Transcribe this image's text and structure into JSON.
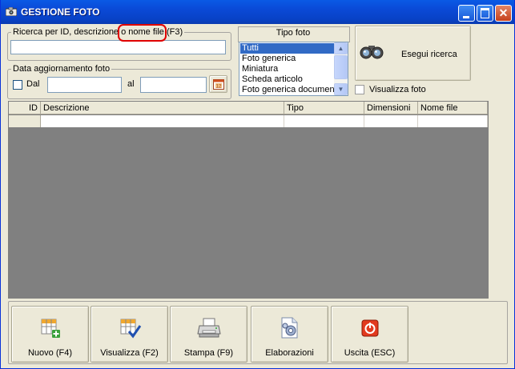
{
  "window": {
    "title": "GESTIONE FOTO"
  },
  "search": {
    "group_label": "Ricerca per ID, descrizione o nome file (F3)",
    "value": "",
    "placeholder": ""
  },
  "date_filter": {
    "group_label": "Data aggiornamento foto",
    "from_label": "Dal",
    "from_value": "",
    "to_label": "al",
    "to_value": ""
  },
  "photo_type": {
    "header": "Tipo foto",
    "options": [
      "Tutti",
      "Foto generica",
      "Miniatura",
      "Scheda articolo",
      "Foto generica document"
    ],
    "selected": "Tutti"
  },
  "actions": {
    "search_button": "Esegui ricerca",
    "show_photo_label": "Visualizza foto"
  },
  "table": {
    "columns": [
      "ID",
      "Descrizione",
      "Tipo",
      "Dimensioni",
      "Nome file"
    ],
    "rows": [
      [
        "",
        "",
        "",
        "",
        ""
      ]
    ]
  },
  "toolbar": {
    "new": "Nuovo (F4)",
    "view": "Visualizza (F2)",
    "print": "Stampa (F9)",
    "process": "Elaborazioni",
    "exit": "Uscita (ESC)"
  },
  "colors": {
    "titlebar": "#0a49d6",
    "selection": "#316ac5",
    "annotation": "#e00000",
    "grid_bg": "#808080"
  }
}
